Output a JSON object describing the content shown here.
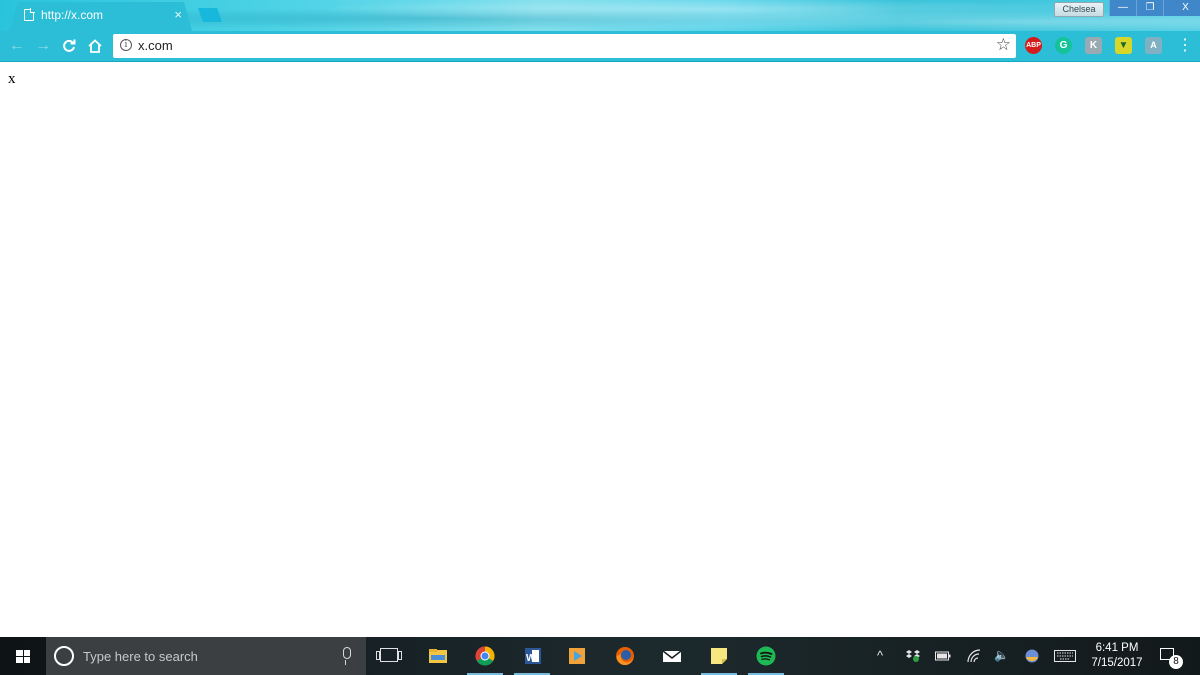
{
  "browser": {
    "tab": {
      "title": "http://x.com",
      "close_glyph": "×",
      "favicon": "page-icon"
    },
    "profile": {
      "name": "Chelsea"
    },
    "window_controls": {
      "minimize": "—",
      "restore": "❐",
      "close": "X"
    },
    "toolbar": {
      "back": "←",
      "forward": "→",
      "reload": "C",
      "home": "⌂",
      "omnibox": {
        "info_glyph": "i",
        "url": "x.com"
      },
      "star": "☆",
      "extensions": [
        {
          "name": "adblock-plus",
          "label": "ABP"
        },
        {
          "name": "grammarly",
          "label": "G"
        },
        {
          "name": "kanji",
          "label": "K"
        },
        {
          "name": "save-to",
          "label": "▼"
        },
        {
          "name": "acrobat",
          "label": "A"
        }
      ],
      "menu": "⋮"
    }
  },
  "page": {
    "text": "x"
  },
  "taskbar": {
    "search_placeholder": "Type here to search",
    "apps": [
      {
        "name": "file-explorer",
        "color": "#f4c542"
      },
      {
        "name": "chrome",
        "color": "#34a853"
      },
      {
        "name": "word",
        "color": "#2b579a",
        "label": "W"
      },
      {
        "name": "media-player",
        "color": "#f1a33a"
      },
      {
        "name": "firefox",
        "color": "#e66000"
      },
      {
        "name": "mail",
        "color": "#ffffff"
      },
      {
        "name": "sticky-notes",
        "color": "#f8e77e"
      },
      {
        "name": "spotify",
        "color": "#1db954"
      }
    ],
    "tray": {
      "chevron": "^",
      "volume": "🔈",
      "clock_time": "6:41 PM",
      "clock_date": "7/15/2017",
      "notification_count": "8"
    }
  }
}
